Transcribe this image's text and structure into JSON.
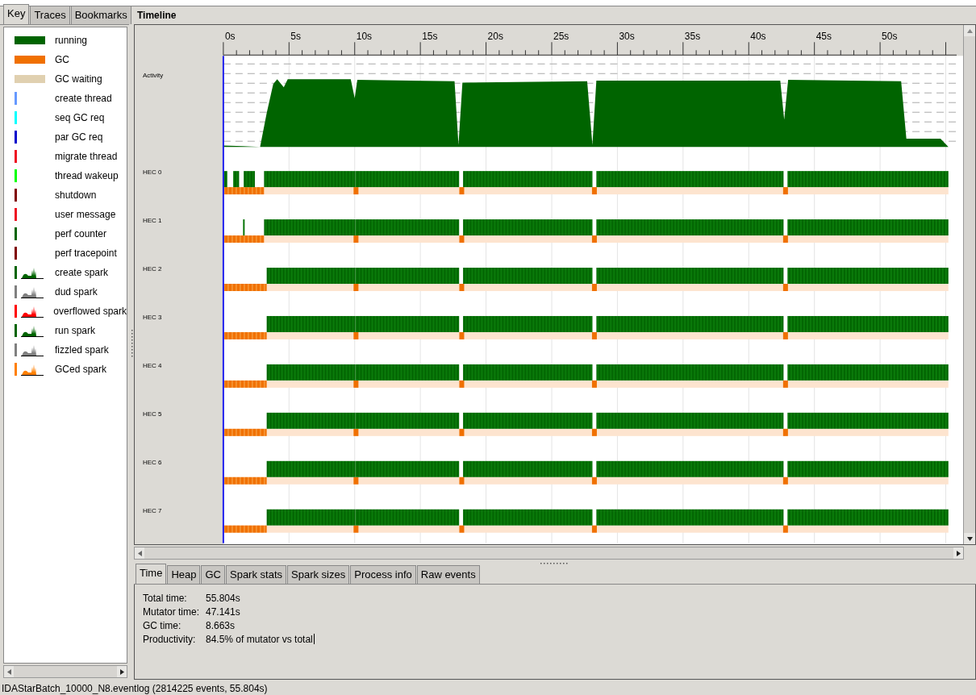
{
  "left_panel": {
    "tabs": [
      {
        "label": "Key",
        "selected": true
      },
      {
        "label": "Traces",
        "selected": false
      },
      {
        "label": "Bookmarks",
        "selected": false
      }
    ],
    "key": [
      {
        "label": "running",
        "kind": "bar",
        "color": "#006400"
      },
      {
        "label": "GC",
        "kind": "bar",
        "color": "#f07000"
      },
      {
        "label": "GC waiting",
        "kind": "bar",
        "color": "#e0d0b0"
      },
      {
        "label": "create thread",
        "kind": "line",
        "color": "#6699ff"
      },
      {
        "label": "seq GC req",
        "kind": "line",
        "color": "#00ffff"
      },
      {
        "label": "par GC req",
        "kind": "line",
        "color": "#0000cc"
      },
      {
        "label": "migrate thread",
        "kind": "line",
        "color": "#ee1122"
      },
      {
        "label": "thread wakeup",
        "kind": "line",
        "color": "#00ff00"
      },
      {
        "label": "shutdown",
        "kind": "line",
        "color": "#800000"
      },
      {
        "label": "user message",
        "kind": "line",
        "color": "#ee1122"
      },
      {
        "label": "perf counter",
        "kind": "line",
        "color": "#006400"
      },
      {
        "label": "perf tracepoint",
        "kind": "line",
        "color": "#800000"
      },
      {
        "label": "create spark",
        "kind": "spark",
        "color": "#006400"
      },
      {
        "label": "dud spark",
        "kind": "spark",
        "color": "#808080"
      },
      {
        "label": "overflowed spark",
        "kind": "spark",
        "color": "#ff0000"
      },
      {
        "label": "run spark",
        "kind": "spark",
        "color": "#006400"
      },
      {
        "label": "fizzled spark",
        "kind": "spark",
        "color": "#808080"
      },
      {
        "label": "GCed spark",
        "kind": "spark",
        "color": "#ff7f00"
      }
    ]
  },
  "timeline": {
    "title": "Timeline",
    "ruler_labels": [
      "0s",
      "5s",
      "10s",
      "15s",
      "20s",
      "25s",
      "30s",
      "35s",
      "40s",
      "45s",
      "50s"
    ],
    "traces": [
      {
        "label": "Activity",
        "kind": "activity"
      },
      {
        "label": "HEC 0",
        "kind": "hec"
      },
      {
        "label": "HEC 1",
        "kind": "hec"
      },
      {
        "label": "HEC 2",
        "kind": "hec"
      },
      {
        "label": "HEC 3",
        "kind": "hec"
      },
      {
        "label": "HEC 4",
        "kind": "hec"
      },
      {
        "label": "HEC 5",
        "kind": "hec"
      },
      {
        "label": "HEC 6",
        "kind": "hec"
      },
      {
        "label": "HEC 7",
        "kind": "hec"
      }
    ]
  },
  "info_tabs": [
    {
      "label": "Time",
      "selected": true
    },
    {
      "label": "Heap",
      "selected": false
    },
    {
      "label": "GC",
      "selected": false
    },
    {
      "label": "Spark stats",
      "selected": false
    },
    {
      "label": "Spark sizes",
      "selected": false
    },
    {
      "label": "Process info",
      "selected": false
    },
    {
      "label": "Raw events",
      "selected": false
    }
  ],
  "info": [
    {
      "label": "Total time:",
      "value": "55.804s"
    },
    {
      "label": "Mutator time:",
      "value": "47.141s"
    },
    {
      "label": "GC time:",
      "value": "8.663s"
    },
    {
      "label": "Productivity:",
      "value": "84.5% of mutator vs total"
    }
  ],
  "status_bar": "IDAStarBatch_10000_N8.eventlog (2814225 events, 55.804s)"
}
